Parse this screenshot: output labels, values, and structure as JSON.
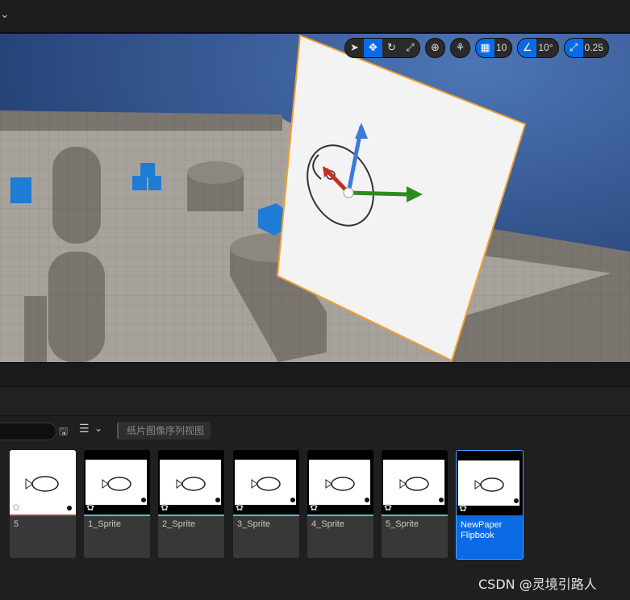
{
  "toolbar": {
    "grid_snap_value": "10",
    "rotation_snap_value": "10°",
    "scale_snap_value": "0.25"
  },
  "content_browser": {
    "breadcrumb": "纸片图像序列视图",
    "tiles": [
      {
        "label": "5"
      },
      {
        "label": "1_Sprite"
      },
      {
        "label": "2_Sprite"
      },
      {
        "label": "3_Sprite"
      },
      {
        "label": "4_Sprite"
      },
      {
        "label": "5_Sprite"
      },
      {
        "label": "NewPaper Flipbook"
      }
    ]
  },
  "watermark": "CSDN @灵境引路人",
  "colors": {
    "accent": "#0a6ae6",
    "sprite_bar": "#3fc7d6",
    "texture_bar": "#c0392b"
  }
}
